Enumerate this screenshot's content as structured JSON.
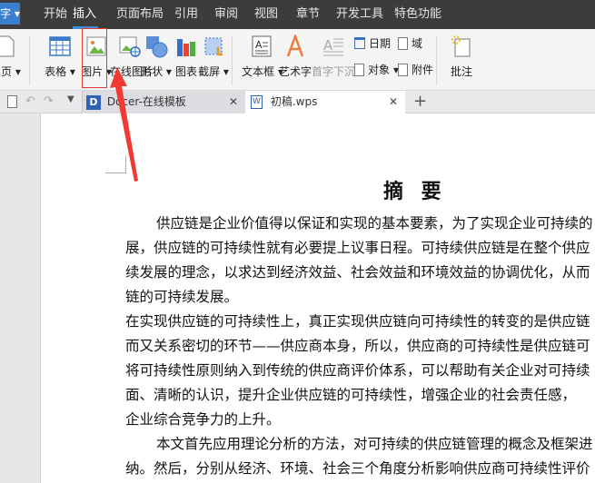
{
  "app_button": "字",
  "menu_tabs": [
    "开始",
    "插入",
    "页面布局",
    "引用",
    "审阅",
    "视图",
    "章节",
    "开发工具",
    "特色功能"
  ],
  "active_tab": "插入",
  "ribbon": {
    "blank_page": "白页",
    "table": "表格",
    "picture": "图片",
    "online_picture": "在线图片",
    "shape": "形状",
    "chart": "图表",
    "screenshot": "截屏",
    "textbox": "文本框",
    "wordart": "艺术字",
    "drop_cap": "首字下沉",
    "date": "日期",
    "field": "域",
    "object": "对象",
    "attachment": "附件",
    "comment": "批注"
  },
  "doc_tabs": [
    {
      "label": "Docer-在线模板"
    },
    {
      "label": "初稿.wps"
    }
  ],
  "document": {
    "title": "摘 要",
    "lines": [
      "供应链是企业价值得以保证和实现的基本要素，为了实现企业可持续的",
      "展，供应链的可持续性就有必要提上议事日程。可持续供应链是在整个供应",
      "续发展的理念，以求达到经济效益、社会效益和环境效益的协调优化，从而",
      "链的可持续发展。",
      "在实现供应链的可持续性上，真正实现供应链向可持续性的转变的是供应链",
      "而又关系密切的环节——供应商本身，所以，供应商的可持续性是供应链可",
      "将可持续性原则纳入到传统的供应商评价体系，可以帮助有关企业对可持续",
      "面、清晰的认识，提升企业供应链的可持续性，增强企业的社会责任感，",
      "企业综合竞争力的上升。",
      "本文首先应用理论分析的方法，对可持续的供应链管理的概念及框架进",
      "纳。然后，分别从经济、环境、社会三个角度分析影响供应商可持续性评价"
    ]
  },
  "colors": {
    "titlebar": "#3c3c3c",
    "accent": "#3b8fd9",
    "highlight": "#e53935"
  }
}
